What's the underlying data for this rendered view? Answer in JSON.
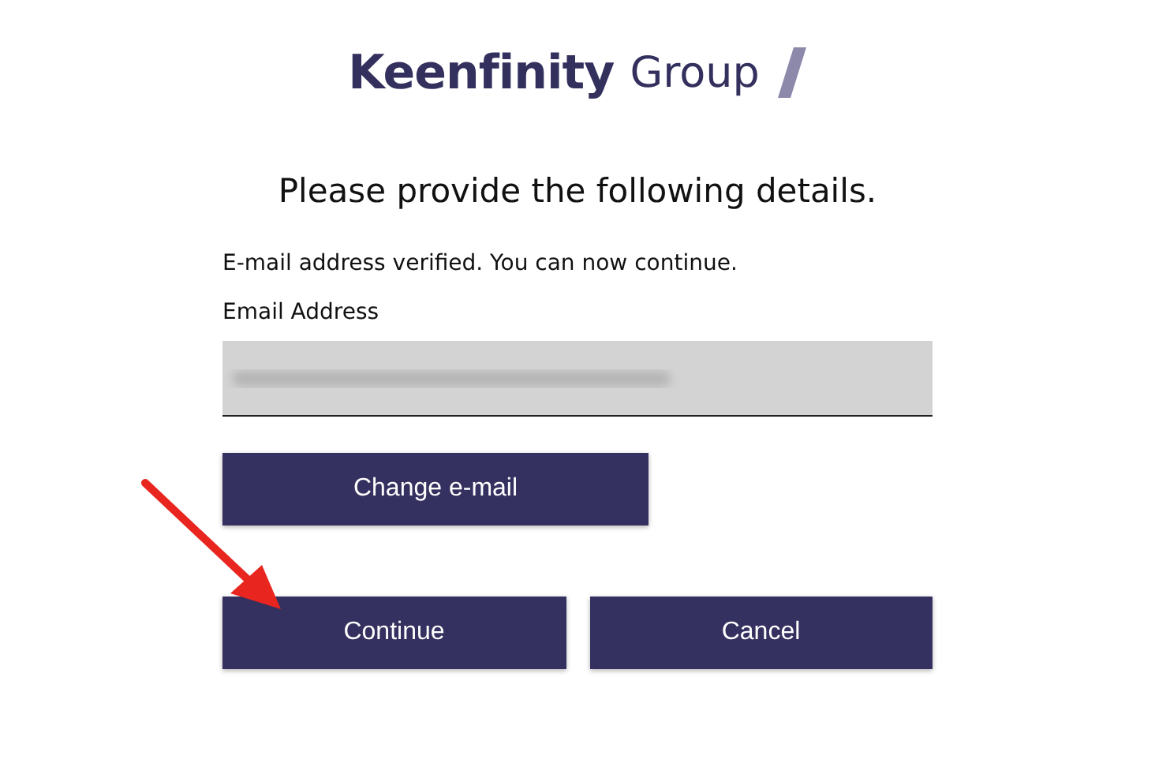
{
  "logo": {
    "name": "Keenfinity",
    "suffix": "Group"
  },
  "heading": "Please provide the following details.",
  "status_message": "E-mail address verified. You can now continue.",
  "email_field": {
    "label": "Email Address"
  },
  "buttons": [
    {
      "label": "Change e-mail",
      "kind": "wide"
    },
    {
      "label": "Continue",
      "kind": "half"
    },
    {
      "label": "Cancel",
      "kind": "half"
    }
  ]
}
